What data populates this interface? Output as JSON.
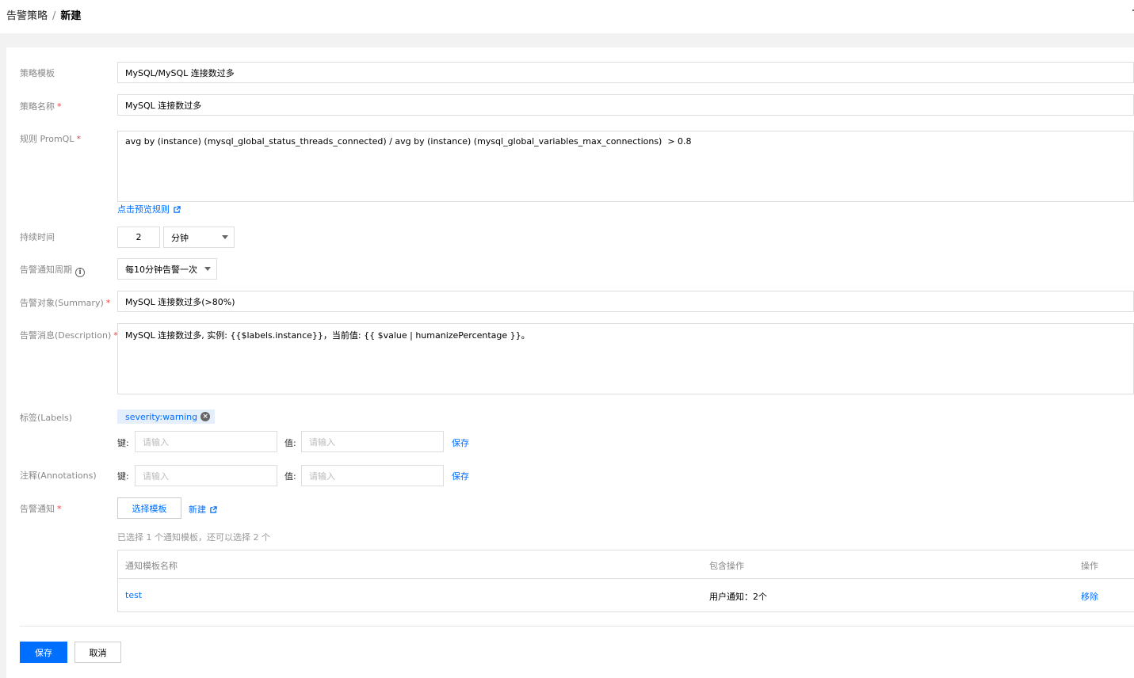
{
  "breadcrumb": {
    "parent": "告警策略",
    "separator": "/",
    "current": "新建"
  },
  "form": {
    "template": {
      "label": "策略模板",
      "value": "MySQL/MySQL 连接数过多"
    },
    "name": {
      "label": "策略名称",
      "value": "MySQL 连接数过多"
    },
    "promql": {
      "label": "规则 PromQL",
      "value": "avg by (instance) (mysql_global_status_threads_connected) / avg by (instance) (mysql_global_variables_max_connections)  > 0.8",
      "preview_link": "点击预览规则"
    },
    "duration": {
      "label": "持续时间",
      "value": "2",
      "unit": "分钟"
    },
    "notify_period": {
      "label": "告警通知周期",
      "value": "每10分钟告警一次"
    },
    "summary": {
      "label": "告警对象(Summary)",
      "value": "MySQL 连接数过多(>80%)"
    },
    "description": {
      "label": "告警消息(Description)",
      "value": "MySQL 连接数过多, 实例: {{$labels.instance}}，当前值: {{ $value | humanizePercentage }}。"
    },
    "labels": {
      "label": "标签(Labels)",
      "tags": [
        "severity:warning"
      ],
      "key_label": "键:",
      "value_label": "值:",
      "key_placeholder": "请输入",
      "value_placeholder": "请输入",
      "save": "保存"
    },
    "annotations": {
      "label": "注释(Annotations)",
      "key_label": "键:",
      "value_label": "值:",
      "key_placeholder": "请输入",
      "value_placeholder": "请输入",
      "save": "保存"
    },
    "notification": {
      "label": "告警通知",
      "select_button": "选择模板",
      "new_link": "新建",
      "hint": "已选择 1 个通知模板，还可以选择 2 个",
      "table": {
        "columns": [
          "通知模板名称",
          "包含操作",
          "操作"
        ],
        "rows": [
          {
            "name": "test",
            "ops": "用户通知：2个",
            "action": "移除"
          }
        ]
      }
    }
  },
  "footer": {
    "save": "保存",
    "cancel": "取消"
  },
  "colors": {
    "primary": "#006eff",
    "required": "#e54545"
  }
}
